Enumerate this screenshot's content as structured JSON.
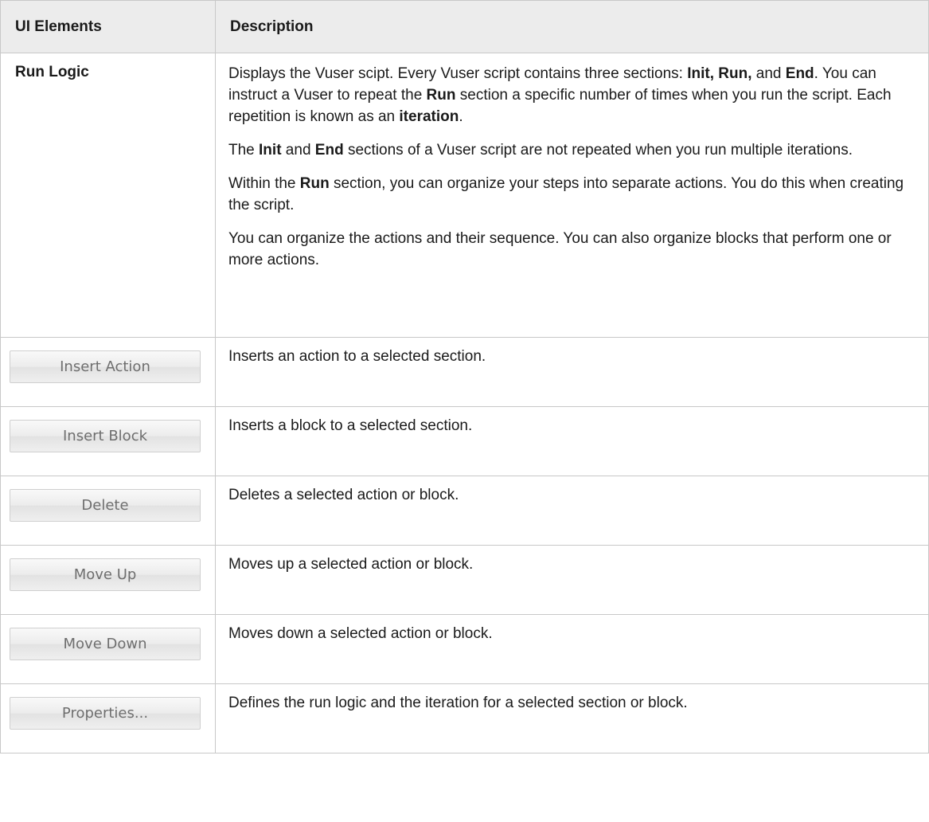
{
  "table": {
    "headers": {
      "elements": "UI Elements",
      "description": "Description"
    },
    "run_logic": {
      "name": "Run Logic",
      "para1": {
        "t1": "Displays the Vuser scipt. Every Vuser script contains three sections: ",
        "b1": "Init,",
        "t2": " ",
        "b2": "Run,",
        "t3": " and ",
        "b3": "End",
        "t4": ". You can instruct a Vuser to repeat the ",
        "b4": "Run",
        "t5": " section a specific number of times when you run the script. Each repetition is known as an ",
        "b5": "iteration",
        "t6": "."
      },
      "para2": {
        "t1": "The ",
        "b1": "Init",
        "t2": " and ",
        "b2": "End",
        "t3": " sections of a Vuser script are not repeated when you run multiple iterations."
      },
      "para3": {
        "t1": "Within the ",
        "b1": "Run",
        "t2": " section, you can organize your steps into separate actions. You do this when creating the script."
      },
      "para4": "You can organize the actions and their sequence. You can also organize blocks that perform one or more actions."
    },
    "rows": [
      {
        "button": "Insert Action",
        "description": "Inserts an action to a selected section."
      },
      {
        "button": "Insert Block",
        "description": "Inserts a block to a selected section."
      },
      {
        "button": "Delete",
        "description": "Deletes a selected action or block."
      },
      {
        "button": "Move Up",
        "description": "Moves up a selected action or block."
      },
      {
        "button": "Move Down",
        "description": "Moves down a selected action or block."
      },
      {
        "button": "Properties...",
        "description": "Defines the run logic and the iteration for a selected section or block."
      }
    ]
  }
}
